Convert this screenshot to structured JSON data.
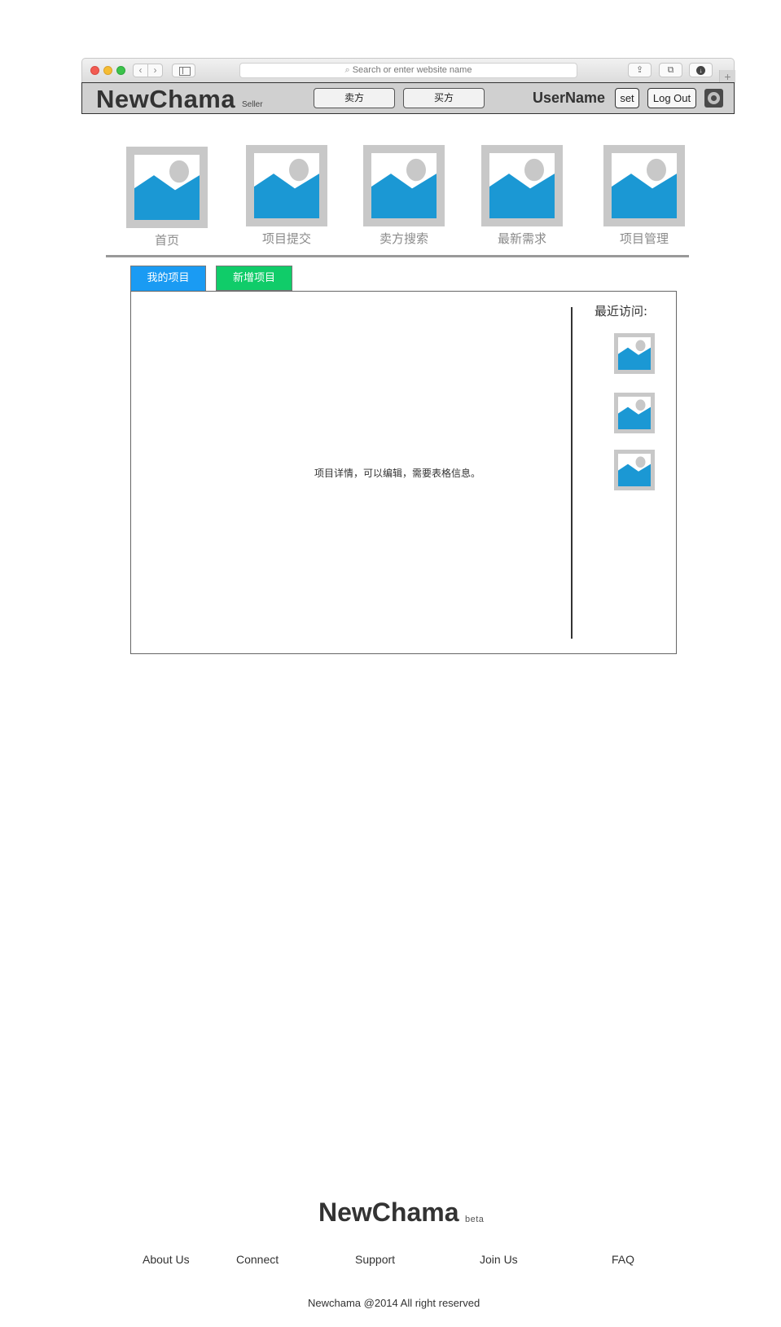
{
  "browser": {
    "back_icon": "‹",
    "forward_icon": "›",
    "address_placeholder": "Search or enter website name",
    "search_icon": "⌕",
    "share_icon": "⇪",
    "tabs_icon": "⧉",
    "download_icon": "↓",
    "newtab_icon": "+"
  },
  "header": {
    "logo": "NewChama",
    "logo_sub": "Seller",
    "seller_button": "卖方",
    "buyer_button": "买方",
    "username": "UserName",
    "set_button": "set",
    "logout_button": "Log Out"
  },
  "nav": {
    "items": [
      {
        "label": "首页"
      },
      {
        "label": "项目提交"
      },
      {
        "label": "卖方搜索"
      },
      {
        "label": "最新需求"
      },
      {
        "label": "项目管理"
      }
    ]
  },
  "tabs": {
    "my_projects": "我的项目",
    "new_project": "新增项目"
  },
  "panel": {
    "detail_text": "项目详情，可以编辑，需要表格信息。",
    "recent_title": "最近访问:"
  },
  "footer": {
    "logo": "NewChama",
    "beta": "beta",
    "links": [
      "About Us",
      "Connect",
      "Support",
      "Join Us",
      "FAQ"
    ],
    "copyright": "Newchama @2014 All right reserved"
  },
  "colors": {
    "tab_my": "#1a9bf3",
    "tab_new": "#10cc69",
    "placeholder_blue": "#1b98d4"
  }
}
